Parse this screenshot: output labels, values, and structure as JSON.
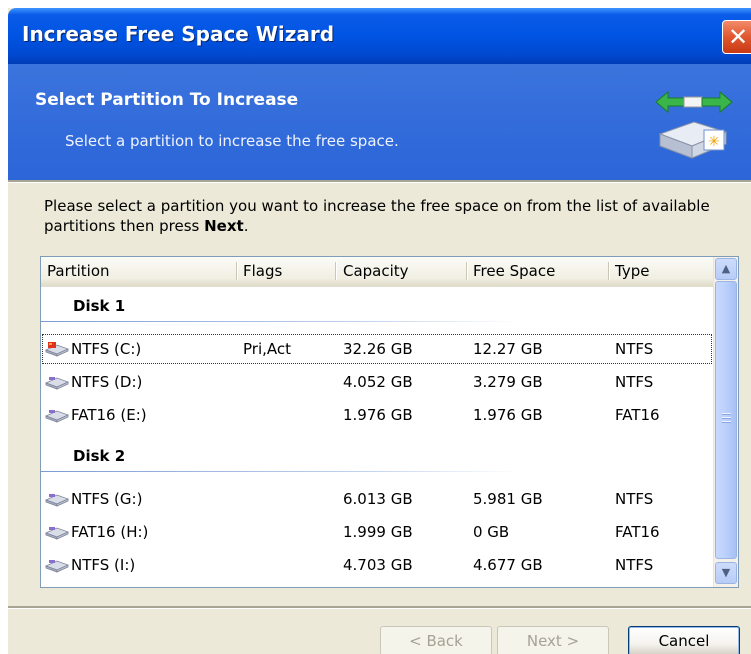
{
  "window": {
    "title": "Increase Free Space Wizard",
    "close_glyph": "✕"
  },
  "header": {
    "title": "Select Partition To Increase",
    "subtitle": "Select a partition to increase the free space.",
    "icon": "disk-resize-icon"
  },
  "instructions": {
    "text_before": "Please select a partition you want to increase the free space on from the list of available partitions then press ",
    "text_bold": "Next",
    "text_after": "."
  },
  "list": {
    "columns": [
      "Partition",
      "Flags",
      "Capacity",
      "Free Space",
      "Type"
    ],
    "groups": [
      {
        "name": "Disk 1",
        "rows": [
          {
            "partition": "NTFS (C:)",
            "flags": "Pri,Act",
            "capacity": "32.26 GB",
            "free": "12.27 GB",
            "type": "NTFS",
            "selected": true,
            "icon": "system-drive-icon"
          },
          {
            "partition": "NTFS (D:)",
            "flags": "",
            "capacity": "4.052 GB",
            "free": "3.279 GB",
            "type": "NTFS",
            "selected": false,
            "icon": "drive-icon"
          },
          {
            "partition": "FAT16 (E:)",
            "flags": "",
            "capacity": "1.976 GB",
            "free": "1.976 GB",
            "type": "FAT16",
            "selected": false,
            "icon": "drive-icon"
          }
        ]
      },
      {
        "name": "Disk 2",
        "rows": [
          {
            "partition": "NTFS (G:)",
            "flags": "",
            "capacity": "6.013 GB",
            "free": "5.981 GB",
            "type": "NTFS",
            "selected": false,
            "icon": "drive-icon"
          },
          {
            "partition": "FAT16 (H:)",
            "flags": "",
            "capacity": "1.999 GB",
            "free": "0 GB",
            "type": "FAT16",
            "selected": false,
            "icon": "drive-icon"
          },
          {
            "partition": "NTFS (I:)",
            "flags": "",
            "capacity": "4.703 GB",
            "free": "4.677 GB",
            "type": "NTFS",
            "selected": false,
            "icon": "drive-icon"
          }
        ]
      }
    ]
  },
  "buttons": {
    "back": {
      "label": "< Back",
      "enabled": false
    },
    "next": {
      "label": "Next >",
      "enabled": false
    },
    "cancel": {
      "label": "Cancel",
      "enabled": true
    }
  },
  "colors": {
    "title_bar": "#0054e3",
    "header_band": "#2f6edc",
    "dialog_bg": "#ece9d8",
    "close_button": "#e0572f"
  }
}
